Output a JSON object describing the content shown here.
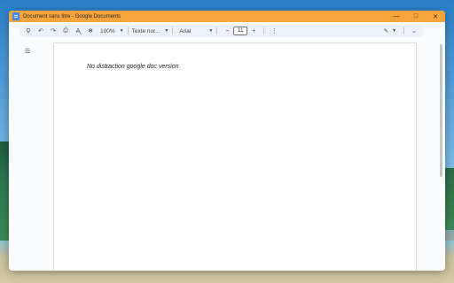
{
  "window": {
    "title": "Document sans titre - Google Documents",
    "minimize_icon": "minimize-icon",
    "maximize_icon": "maximize-icon",
    "close_icon": "close-icon"
  },
  "toolbar": {
    "zoom": "100%",
    "style": "Texte nor...",
    "font": "Arial",
    "font_size": "11",
    "decrease": "−",
    "increase": "+"
  },
  "document": {
    "text": "No distraction google doc version"
  },
  "colors": {
    "titlebar": "#f6a43c",
    "toolbar": "#edf2fa",
    "page": "#ffffff"
  }
}
